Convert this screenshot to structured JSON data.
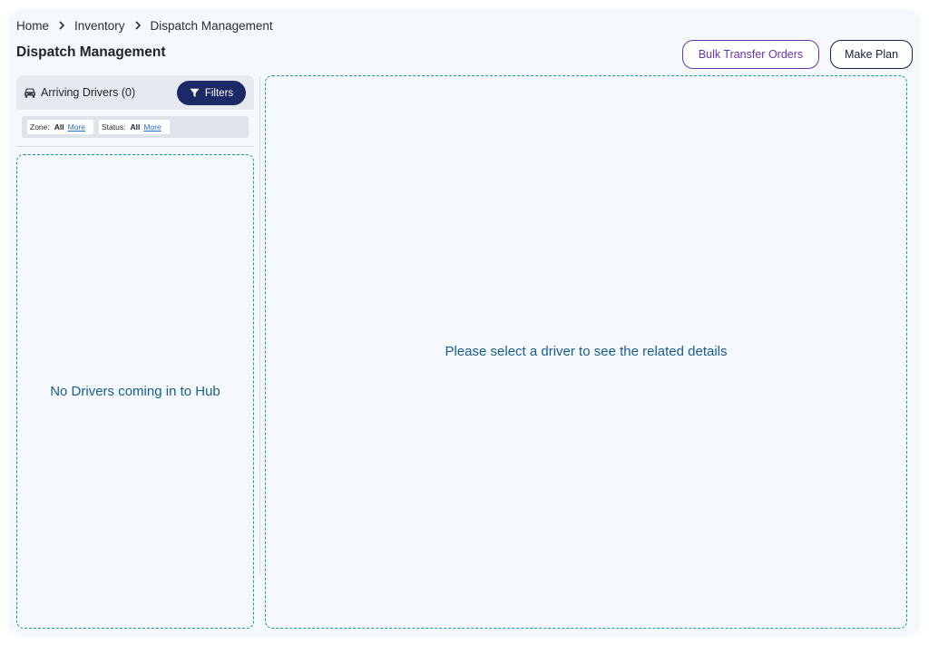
{
  "breadcrumb": [
    "Home",
    "Inventory",
    "Dispatch Management"
  ],
  "page_title": "Dispatch Management",
  "actions": {
    "bulk_transfer": "Bulk Transfer Orders",
    "make_plan": "Make Plan"
  },
  "drivers_panel": {
    "title": "Arriving Drivers (0)",
    "filters_label": "Filters",
    "chips": {
      "zone": {
        "label": "Zone:",
        "value": "All",
        "more": "More"
      },
      "status": {
        "label": "Status:",
        "value": "All",
        "more": "More"
      }
    },
    "empty_message": "No Drivers coming in to Hub"
  },
  "details_panel": {
    "empty_message": "Please select a driver to see the related details"
  },
  "colors": {
    "accent_navy": "#1b2a66",
    "bulk_purple": "#6a35b1",
    "dashed_border": "#1d93b8",
    "empty_text": "#175e8f",
    "link_blue": "#2a6fd6"
  },
  "icons": [
    "chevron-right-icon",
    "car-icon",
    "filter-icon"
  ]
}
